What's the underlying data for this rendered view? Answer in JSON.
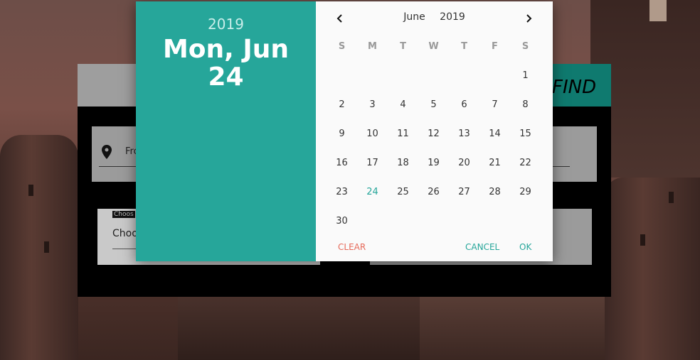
{
  "background": {
    "find_button_label": "FIND"
  },
  "form": {
    "from_partial": "Fro",
    "date_label_partial": "Choos",
    "date_value_partial": "Choo"
  },
  "picker": {
    "header": {
      "year": "2019",
      "date_line1": "Mon, Jun",
      "date_line2": "24"
    },
    "month": "June",
    "year": "2019",
    "weekdays": [
      "S",
      "M",
      "T",
      "W",
      "T",
      "F",
      "S"
    ],
    "leading_blanks": 6,
    "days": [
      "1",
      "2",
      "3",
      "4",
      "5",
      "6",
      "7",
      "8",
      "9",
      "10",
      "11",
      "12",
      "13",
      "14",
      "15",
      "16",
      "17",
      "18",
      "19",
      "20",
      "21",
      "22",
      "23",
      "24",
      "25",
      "26",
      "27",
      "28",
      "29",
      "30"
    ],
    "selected_day": "24",
    "clear_label": "CLEAR",
    "cancel_label": "CANCEL",
    "ok_label": "OK",
    "colors": {
      "accent": "#26a69a",
      "clear": "#e66a5a"
    }
  }
}
